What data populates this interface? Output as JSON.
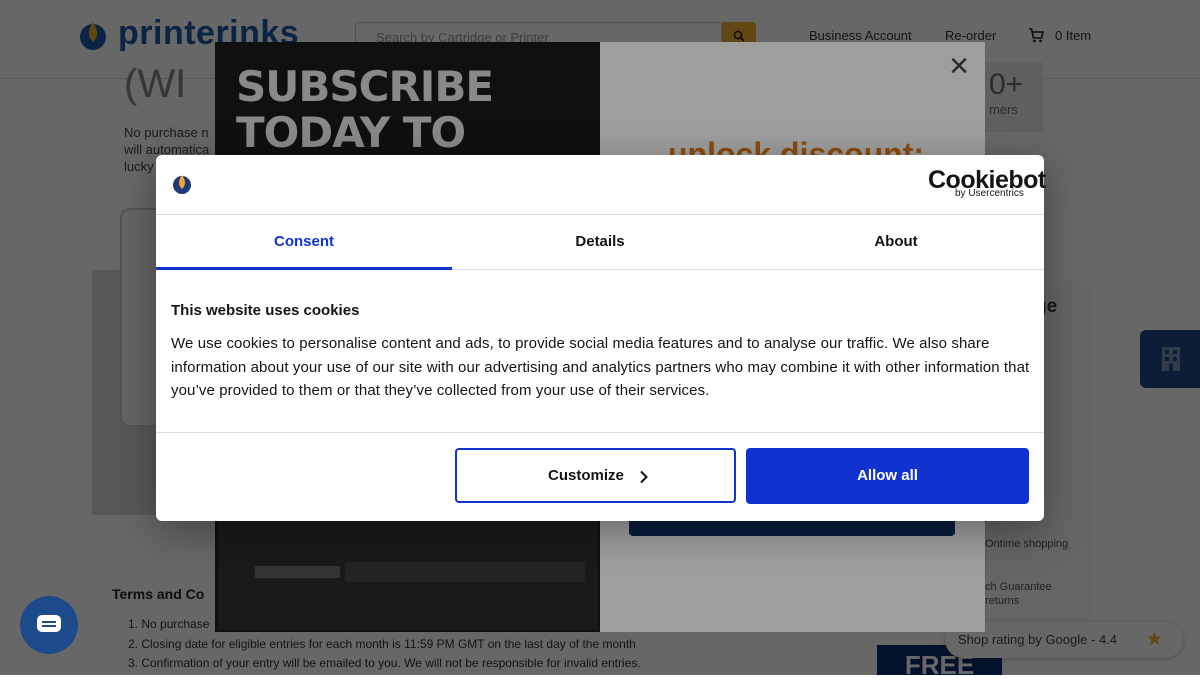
{
  "site": {
    "logo_text": "printerinks",
    "search_placeholder": "Search by Cartridge or Printer",
    "nav": {
      "business_account": "Business Account",
      "reorder": "Re-order",
      "cart": "0 Item"
    }
  },
  "background": {
    "promo_heading": "(WI",
    "promo_text": "No purchase n will automatica lucky p of ink",
    "stat_value": "0+",
    "stat_label": "mers",
    "panel_title": "ge",
    "panel_line1": "Ontime shopping",
    "panel_line2": "ch Guarantee returns",
    "terms_title": "Terms and Co",
    "terms_items": [
      "1. No purchase",
      "2. Closing date for eligible entries for each month is 11:59 PM GMT on the last day of the month",
      "3. Confirmation of your entry will be emailed to you. We will not be responsible for invalid entries."
    ],
    "google_rating_text": "Shop rating by Google",
    "google_rating_value": "4.4",
    "free_banner": "FREE"
  },
  "subscribe_popup": {
    "heading": "SUBSCRIBE TODAY TO RECEIVE THE MOST",
    "offer": "unlock discount:",
    "close_label": "×"
  },
  "cookie_dialog": {
    "brand": "Cookiebot",
    "brand_sub": "by Usercentrics",
    "tabs": [
      "Consent",
      "Details",
      "About"
    ],
    "active_tab": "Consent",
    "heading": "This website uses cookies",
    "body": "We use cookies to personalise content and ads, to provide social media features and to analyse our traffic. We also share information about your use of our site with our advertising and analytics partners who may combine it with other information that you’ve provided to them or that they’ve collected from your use of their services.",
    "customize_label": "Customize",
    "allow_all_label": "Allow all",
    "accent_color": "#1032cf"
  },
  "icons": [
    "search-icon",
    "cart-icon",
    "close-icon",
    "chevron-right-icon",
    "chat-icon",
    "building-icon",
    "star-icon",
    "cookiebot-logo-icon"
  ]
}
